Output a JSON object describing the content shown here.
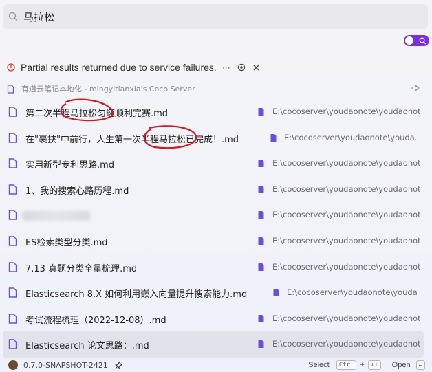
{
  "search": {
    "value": "马拉松"
  },
  "notice": {
    "text": "Partial results returned due to service failures.",
    "more_label": "···"
  },
  "source": {
    "label": "有道云笔记本地化 - mingyitianxia's Coco Server"
  },
  "results": [
    {
      "name": "第二次半程马拉松匀速顺利完赛.md",
      "path": "E:\\cocoserver\\youdaonote\\youdaonote"
    },
    {
      "name": "在\"裹挟\"中前行，人生第一次半程马拉松已完成！.md",
      "path": "E:\\cocoserver\\youdaonote\\youda..."
    },
    {
      "name": "实用新型专利思路.md",
      "path": "E:\\cocoserver\\youdaonote\\youdaonote"
    },
    {
      "name": "1、我的搜索心路历程.md",
      "path": "E:\\cocoserver\\youdaonote\\youdaonote"
    },
    {
      "name": "",
      "path": "E:\\cocoserver\\youdaonote\\youdaonote"
    },
    {
      "name": "ES检索类型分类.md",
      "path": "E:\\cocoserver\\youdaonote\\youdaonote"
    },
    {
      "name": "7.13 真题分类全量梳理.md",
      "path": "E:\\cocoserver\\youdaonote\\youdaonote"
    },
    {
      "name": "Elasticsearch 8.X 如何利用嵌入向量提升搜索能力.md",
      "path": "E:\\cocoserver\\youdaonote\\youda..."
    },
    {
      "name": "考试流程梳理（2022-12-08）.md",
      "path": "E:\\cocoserver\\youdaonote\\youdaonote"
    },
    {
      "name": "Elasticsearch 论文思路：.md",
      "path": "E:\\cocoserver\\youdaonote\\youdaonote"
    }
  ],
  "footer": {
    "version": "0.7.0-SNAPSHOT-2421",
    "select_label": "Select",
    "select_key1": "Ctrl",
    "select_plus": "+",
    "select_key2": "↓↑",
    "open_label": "Open",
    "open_key": "↵"
  },
  "colors": {
    "accent": "#7b2fe0",
    "file_icon": "#6b4fd8",
    "annotation": "#d21a27",
    "error": "#d0342c"
  },
  "icons": {
    "search": "search-icon",
    "file": "file-icon",
    "folder": "folder-icon",
    "pin": "pin-icon",
    "arrow": "arrow-right-icon"
  }
}
